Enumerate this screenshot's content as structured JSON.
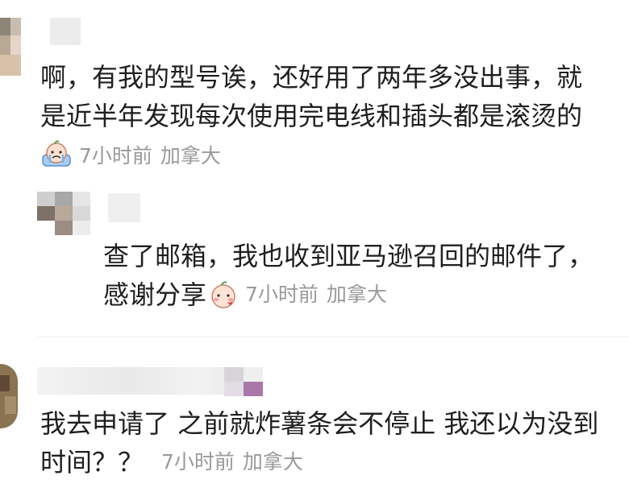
{
  "comments": [
    {
      "line1": "啊，有我的型号诶，还好用了两年多没出事，就",
      "line2": "是近半年发现每次使用完电线和插头都是滚烫的",
      "sticker": "crying-face-sticker",
      "time": "7小时前",
      "location": "加拿大"
    },
    {
      "line1": "查了邮箱，我也收到亚马逊召回的邮件了，",
      "line2": "感谢分享",
      "sticker": "blushing-face-sticker",
      "time": "7小时前",
      "location": "加拿大"
    },
    {
      "line1": "我去申请了 之前就炸薯条会不停止 我还以为没到",
      "line2": "时间？？",
      "time": "7小时前",
      "location": "加拿大"
    }
  ]
}
